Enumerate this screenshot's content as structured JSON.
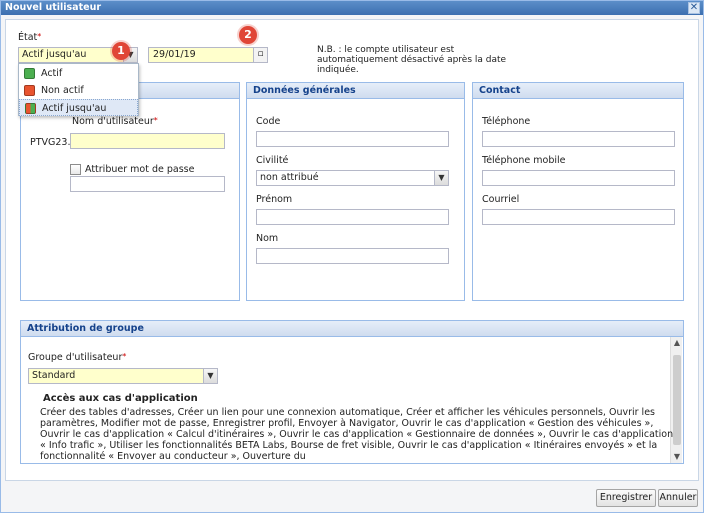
{
  "window": {
    "title": "Nouvel utilisateur",
    "close_glyph": "✕"
  },
  "etat": {
    "label": "État",
    "required": "*",
    "value": "Actif jusqu'au",
    "date": "29/01/19",
    "note": "N.B. : le compte utilisateur est automatiquement désactivé après la date indiquée.",
    "markers": [
      "1",
      "2"
    ],
    "options": [
      {
        "label": "Actif",
        "color": "#4caf50"
      },
      {
        "label": "Non actif",
        "color": "#e8542f"
      },
      {
        "label": "Actif jusqu'au",
        "color": "#e8542f",
        "color2": "#4caf50"
      }
    ]
  },
  "identity": {
    "username_label": "Nom d'utilisateur",
    "required": "*",
    "prefix": "PTVG23.",
    "password_label": "Attribuer mot de passe"
  },
  "general": {
    "title": "Données générales",
    "code_label": "Code",
    "civilite_label": "Civilité",
    "civilite_value": "non attribué",
    "prenom_label": "Prénom",
    "nom_label": "Nom"
  },
  "contact": {
    "title": "Contact",
    "phone_label": "Téléphone",
    "mobile_label": "Téléphone mobile",
    "email_label": "Courriel"
  },
  "group": {
    "title": "Attribution de groupe",
    "group_label": "Groupe d'utilisateur",
    "required": "*",
    "group_value": "Standard",
    "access_title": "Accès aux cas d'application",
    "access_text": "Créer des tables d'adresses, Créer un lien pour une connexion automatique, Créer et afficher les véhicules personnels, Ouvrir les paramètres, Modifier mot de passe, Enregistrer profil, Envoyer à Navigator, Ouvrir le cas d'application « Gestion des véhicules », Ouvrir le cas d'application « Calcul d'itinéraires », Ouvrir le cas d'application « Gestionnaire de données », Ouvrir le cas d'application « Info trafic », Utiliser les fonctionnalités BETA Labs, Bourse de fret visible, Ouvrir le cas d'application « Itinéraires envoyés » et la fonctionnalité « Envoyer au conducteur », Ouverture du"
  },
  "footer": {
    "save": "Enregistrer",
    "cancel": "Annuler"
  }
}
